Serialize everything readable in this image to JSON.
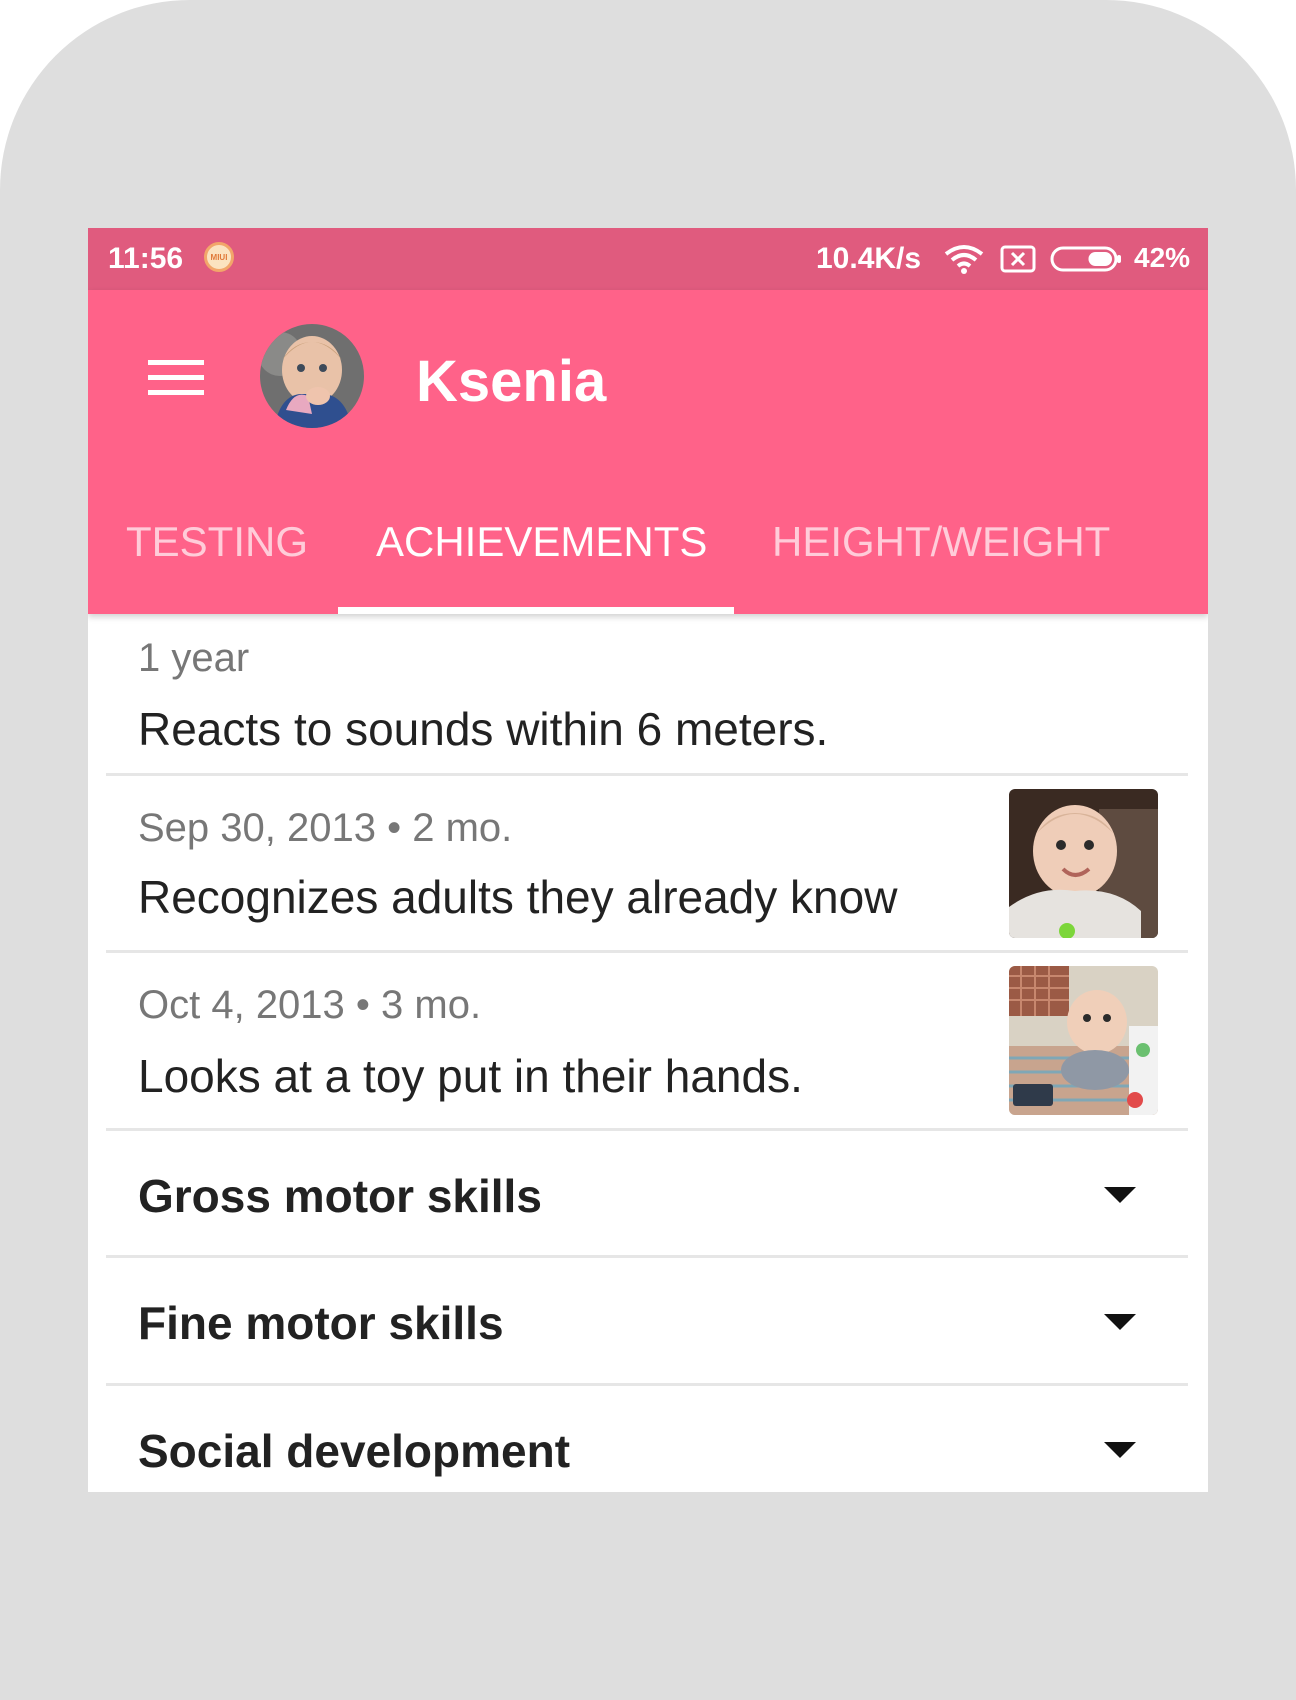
{
  "status_bar": {
    "time": "11:56",
    "notification_badge": "MIUI",
    "network_speed": "10.4K/s",
    "battery_percent": "42%",
    "battery_level": 0.42
  },
  "app_bar": {
    "title": "Ksenia",
    "color": "#ff6289"
  },
  "tabs": [
    {
      "label": "TESTING",
      "active": false
    },
    {
      "label": "ACHIEVEMENTS",
      "active": true
    },
    {
      "label": "HEIGHT/WEIGHT",
      "active": false
    }
  ],
  "achievements": [
    {
      "meta": "1 year",
      "text": "Reacts to sounds within 6 meters.",
      "has_photo": false
    },
    {
      "meta": "Sep 30, 2013 • 2 mo.",
      "text": "Recognizes adults they already know",
      "has_photo": true
    },
    {
      "meta": "Oct 4, 2013 • 3 mo.",
      "text": "Looks at a toy put in their hands.",
      "has_photo": true
    }
  ],
  "sections": [
    {
      "label": "Gross motor skills"
    },
    {
      "label": "Fine motor skills"
    },
    {
      "label": "Social development"
    }
  ]
}
